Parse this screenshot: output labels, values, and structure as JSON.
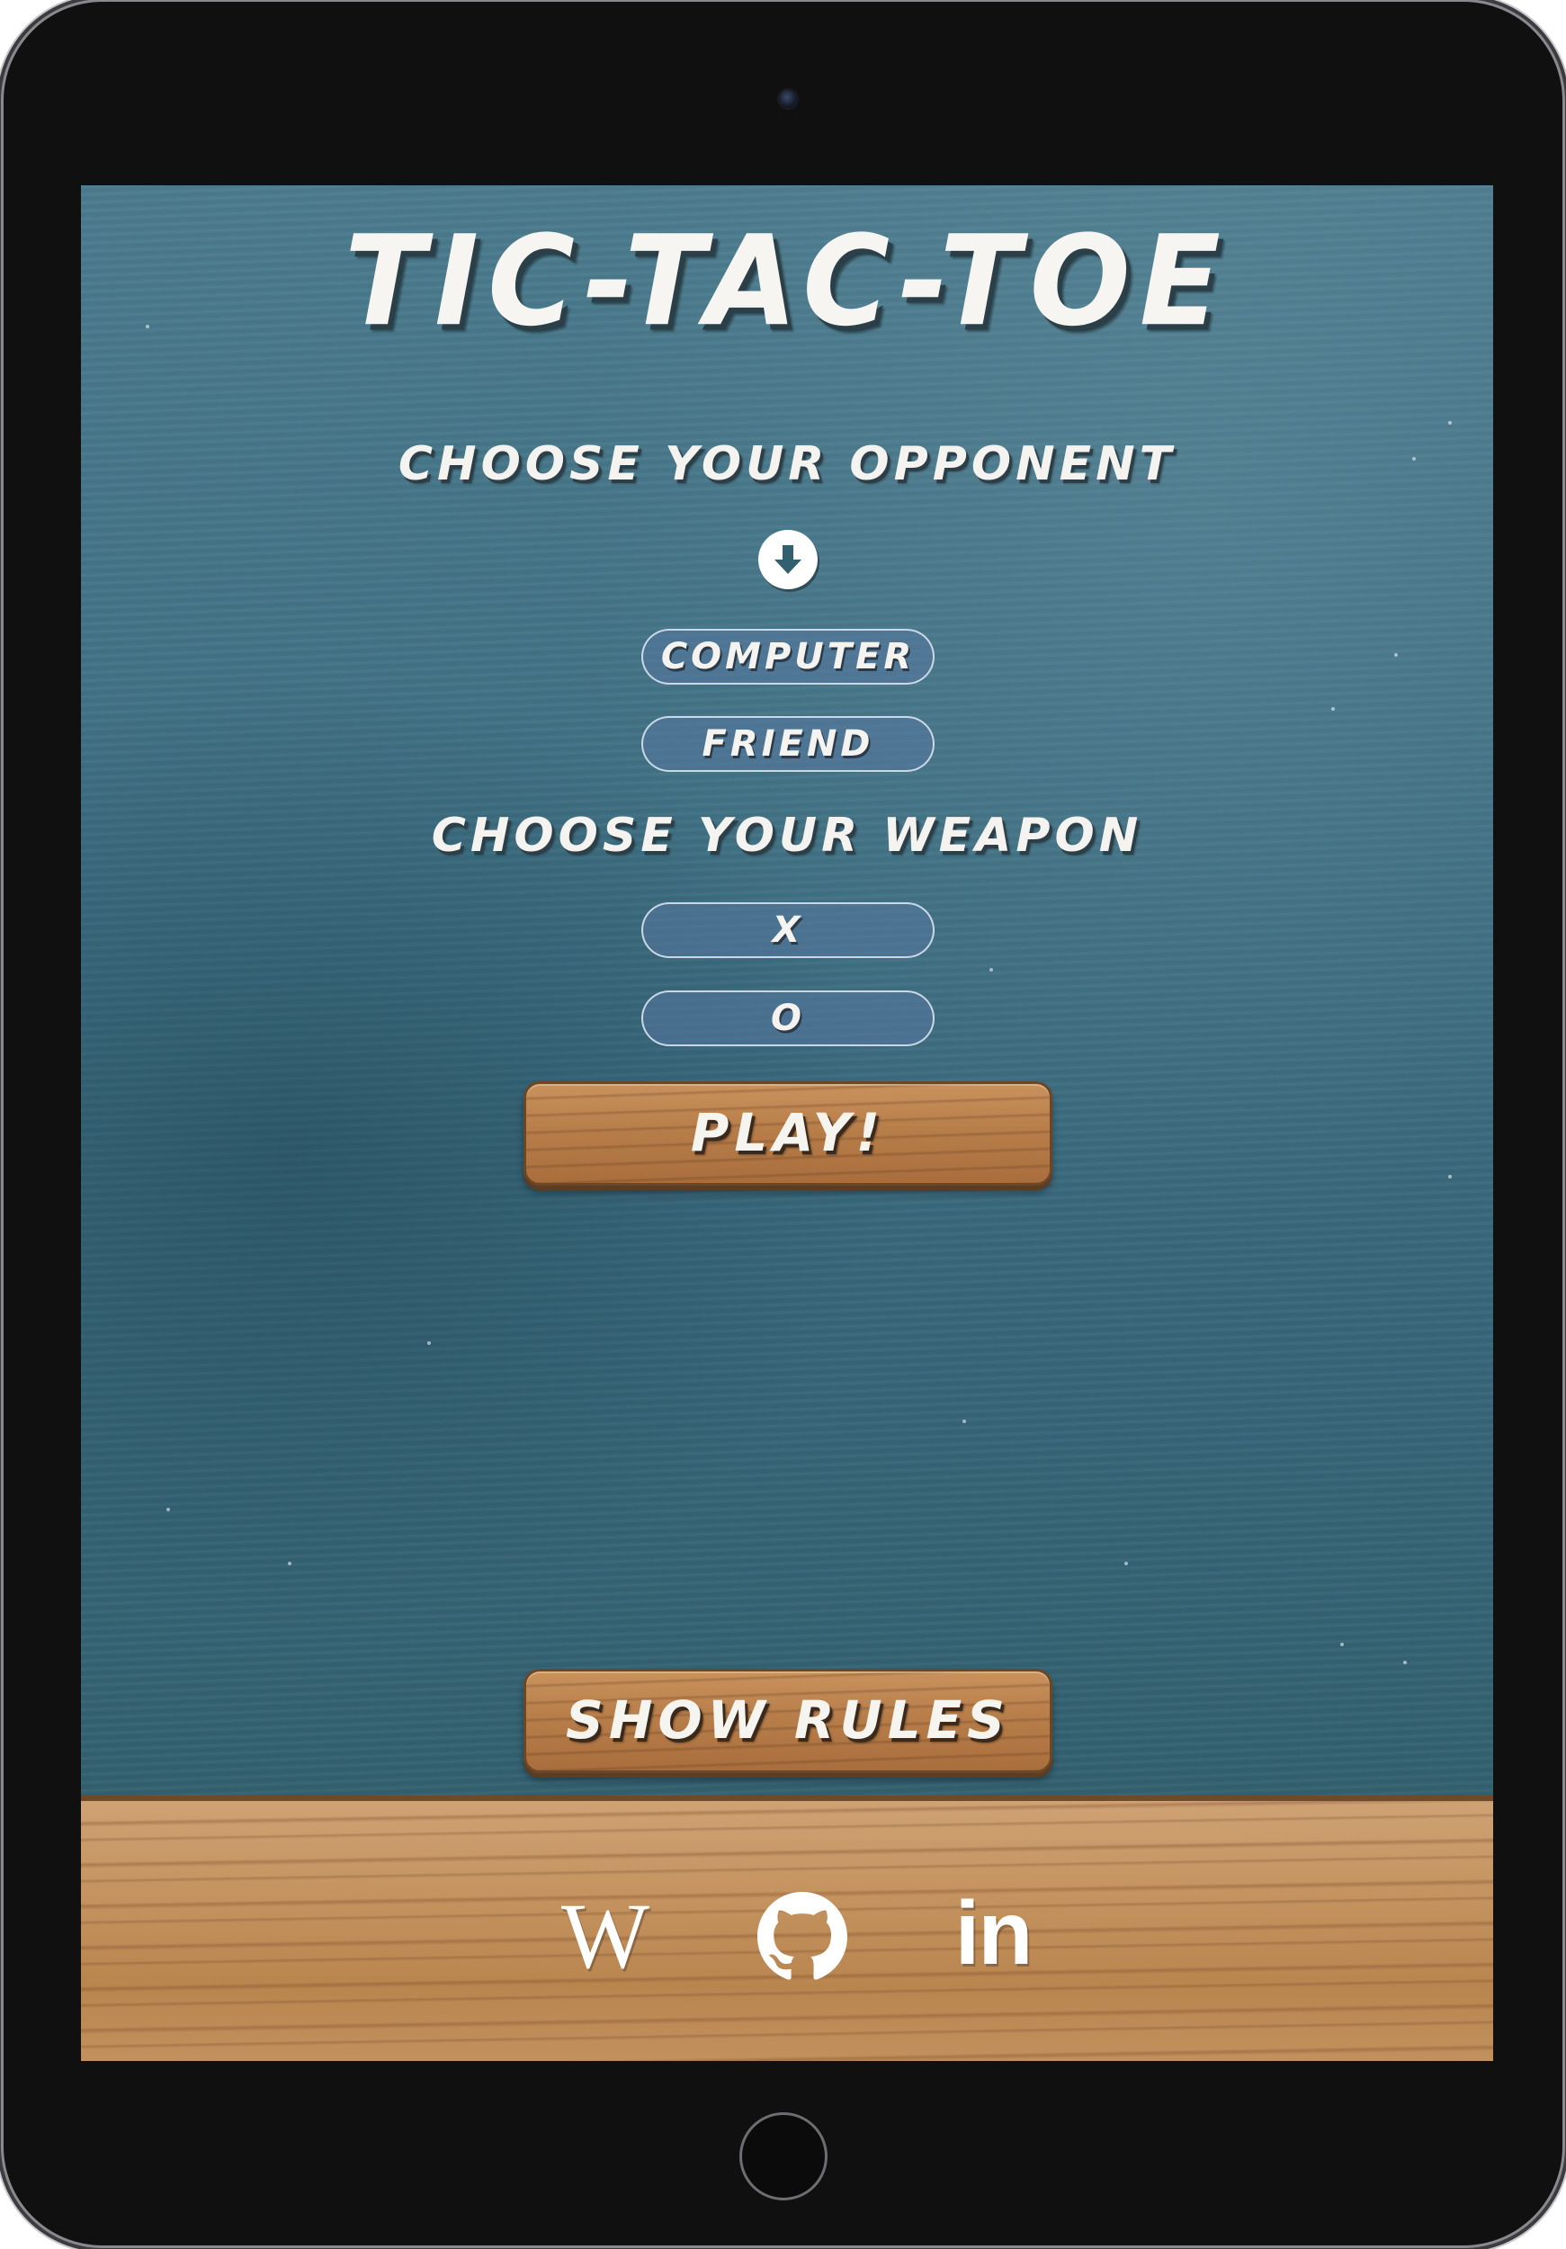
{
  "app": {
    "title": "TIC-TAC-TOE"
  },
  "setup": {
    "opponent_heading": "CHOOSE YOUR OPPONENT",
    "opponent_options": [
      "COMPUTER",
      "FRIEND"
    ],
    "weapon_heading": "CHOOSE YOUR WEAPON",
    "weapon_options": [
      "X",
      "O"
    ],
    "play_label": "PLAY!",
    "down_icon": "arrow-down-circle-icon"
  },
  "footer": {
    "rules_label": "SHOW RULES",
    "links": [
      {
        "name": "wikipedia-icon",
        "text": "W"
      },
      {
        "name": "github-icon",
        "text": ""
      },
      {
        "name": "linkedin-icon",
        "text": "in"
      }
    ]
  },
  "colors": {
    "board": "#3e6f82",
    "wood": "#c4935f",
    "text": "#f4f3ef",
    "device": "#101011"
  }
}
